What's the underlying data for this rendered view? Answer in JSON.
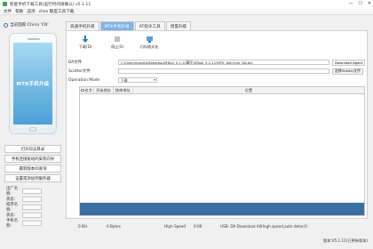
{
  "window": {
    "title": "智能手机下载工具(运行时间请确认) v5.1.11",
    "menu_items": [
      "文件",
      "帮助",
      "选项",
      "ches 额度工具下载"
    ],
    "controls": [
      "—",
      "☐",
      "✕"
    ]
  },
  "left": {
    "country": "当前国家:China 'CN'",
    "phone_screen_text": "MTK手机升级",
    "buttons": [
      "打开日志目录",
      "手机连接驱动的安装向导",
      "最新版本ID查询",
      "设置或添加到服务器"
    ],
    "fields": [
      "出厂名称:",
      "状态:",
      "程序名称:",
      "状态:",
      "手机名称:"
    ]
  },
  "tabs": [
    "高通手机升级",
    "MTK手机升级",
    "AT指令工具",
    "增量升级"
  ],
  "toolbar": [
    {
      "label": "下载(D)",
      "icon": "download-icon"
    },
    {
      "label": "停止(S)",
      "icon": "stop-icon"
    },
    {
      "label": "闪存格式化",
      "icon": "format-icon"
    }
  ],
  "form": {
    "da_label": "DA文件",
    "da_value": "C:\\Users\\hackhe\\Desktop\\MTool_5.1.11解压\\MTool_5.1.11\\MTK_AllInOne_DA.bin",
    "da_button": "Download Agent",
    "scatter_label": "Scatter文件",
    "scatter_value": "",
    "scatter_button": "选择Scatter文件",
    "op_label": "Operation Mode",
    "op_value": "下载"
  },
  "table": {
    "headers": [
      "名字",
      "开始地址",
      "结束地址",
      "位置"
    ]
  },
  "status": {
    "speed": "0 B/s",
    "bytes": "0 Bytes",
    "mode": "High Speed",
    "time": "0:00",
    "message": "USB: DA Download All(high speed,auto detect)"
  },
  "footer": "版本:V5.1.11(已更新版本)",
  "colors": {
    "tab_active": "#7fb3e3",
    "progress": "#3b6fa2"
  }
}
